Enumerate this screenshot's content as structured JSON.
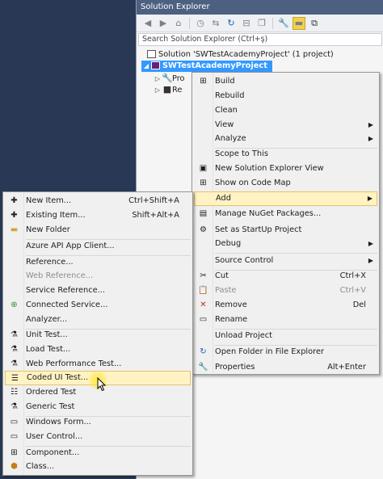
{
  "solution_explorer": {
    "title": "Solution Explorer",
    "search_placeholder": "Search Solution Explorer (Ctrl+ş)",
    "tree": {
      "solution_label": "Solution 'SWTestAcademyProject' (1 project)",
      "project_label": "SWTestAcademyProject",
      "child1": "Pro",
      "child2": "Re"
    }
  },
  "project_menu": {
    "build": "Build",
    "rebuild": "Rebuild",
    "clean": "Clean",
    "view": "View",
    "analyze": "Analyze",
    "scope_to_this": "Scope to This",
    "new_se_view": "New Solution Explorer View",
    "show_on_code_map": "Show on Code Map",
    "add": "Add",
    "manage_nuget": "Manage NuGet Packages...",
    "set_startup": "Set as StartUp Project",
    "debug": "Debug",
    "source_control": "Source Control",
    "cut": "Cut",
    "cut_sc": "Ctrl+X",
    "paste": "Paste",
    "paste_sc": "Ctrl+V",
    "remove": "Remove",
    "remove_sc": "Del",
    "rename": "Rename",
    "unload_project": "Unload Project",
    "open_folder": "Open Folder in File Explorer",
    "properties": "Properties",
    "properties_sc": "Alt+Enter"
  },
  "add_menu": {
    "new_item": "New Item...",
    "new_item_sc": "Ctrl+Shift+A",
    "existing_item": "Existing Item...",
    "existing_item_sc": "Shift+Alt+A",
    "new_folder": "New Folder",
    "azure_api": "Azure API App Client...",
    "reference": "Reference...",
    "web_reference": "Web Reference...",
    "service_reference": "Service Reference...",
    "connected_service": "Connected Service...",
    "analyzer": "Analyzer...",
    "unit_test": "Unit Test...",
    "load_test": "Load Test...",
    "web_perf_test": "Web Performance Test...",
    "coded_ui_test": "Coded UI Test...",
    "ordered_test": "Ordered Test",
    "generic_test": "Generic Test",
    "windows_form": "Windows Form...",
    "user_control": "User Control...",
    "component": "Component...",
    "class": "Class..."
  }
}
